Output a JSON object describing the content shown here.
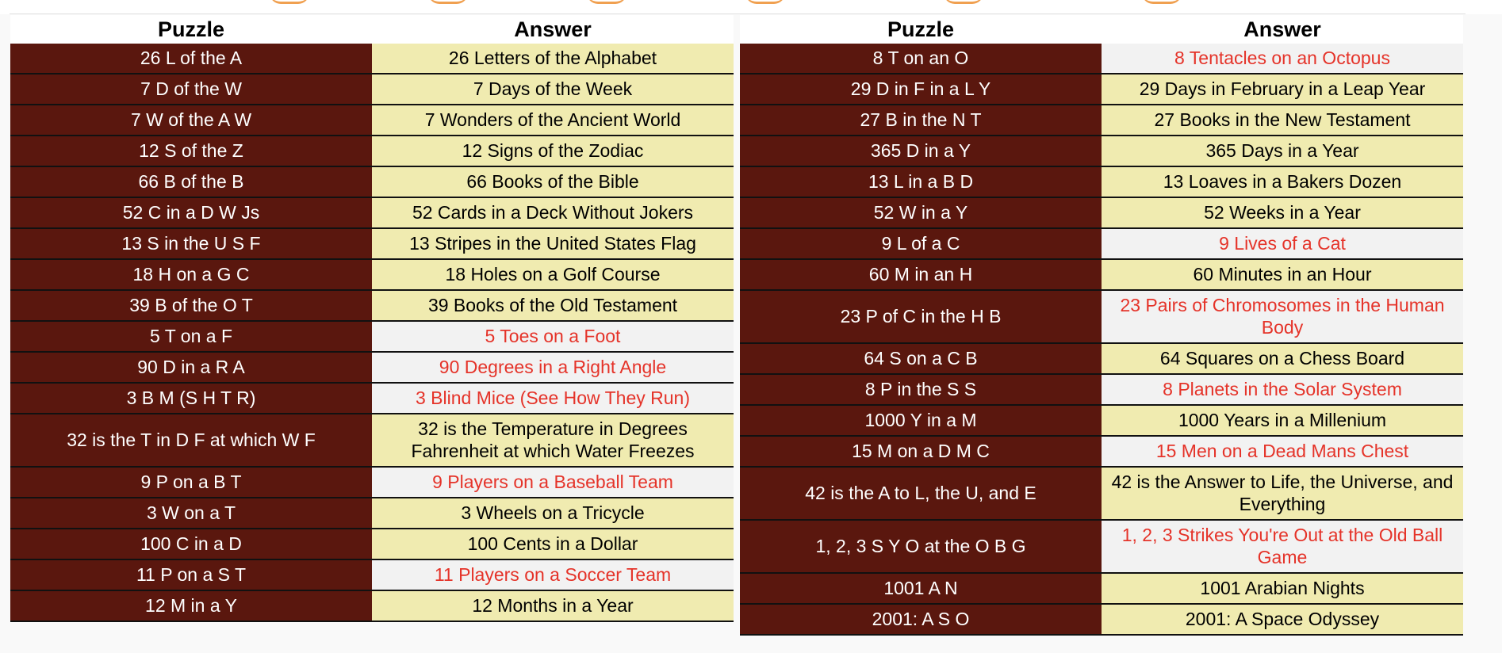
{
  "headers": {
    "puzzle": "Puzzle",
    "answer": "Answer"
  },
  "colors": {
    "puzzle_bg": "#5a170e",
    "answer_bg": "#f0ebb0",
    "highlight_bg": "#f2f2f2",
    "highlight_text": "#e53329"
  },
  "left_rows": [
    {
      "puzzle": "26 L of the A",
      "answer": "26 Letters of the Alphabet",
      "highlighted": false
    },
    {
      "puzzle": "7 D of the W",
      "answer": "7 Days of the Week",
      "highlighted": false
    },
    {
      "puzzle": "7 W of the A W",
      "answer": "7 Wonders of the Ancient World",
      "highlighted": false
    },
    {
      "puzzle": "12 S of the Z",
      "answer": "12 Signs of the Zodiac",
      "highlighted": false
    },
    {
      "puzzle": "66 B of the B",
      "answer": "66 Books of the Bible",
      "highlighted": false
    },
    {
      "puzzle": "52 C in a D W Js",
      "answer": "52 Cards in a Deck Without Jokers",
      "highlighted": false
    },
    {
      "puzzle": "13 S in the U S F",
      "answer": "13 Stripes in the United States Flag",
      "highlighted": false
    },
    {
      "puzzle": "18 H on a G C",
      "answer": "18 Holes on a Golf Course",
      "highlighted": false
    },
    {
      "puzzle": "39 B of the O T",
      "answer": "39 Books of the Old Testament",
      "highlighted": false
    },
    {
      "puzzle": "5 T on a F",
      "answer": "5 Toes on a Foot",
      "highlighted": true
    },
    {
      "puzzle": "90 D in a R A",
      "answer": "90 Degrees in a Right Angle",
      "highlighted": true
    },
    {
      "puzzle": "3 B M (S H T R)",
      "answer": "3 Blind Mice (See How They Run)",
      "highlighted": true
    },
    {
      "puzzle": "32 is the T in D F at which W F",
      "answer": "32 is the Temperature in Degrees Fahrenheit at which Water Freezes",
      "highlighted": false
    },
    {
      "puzzle": "9 P on a B T",
      "answer": "9 Players on a Baseball Team",
      "highlighted": true
    },
    {
      "puzzle": "3 W on a T",
      "answer": "3 Wheels on a Tricycle",
      "highlighted": false
    },
    {
      "puzzle": "100 C in a D",
      "answer": "100 Cents in a Dollar",
      "highlighted": false
    },
    {
      "puzzle": "11 P on a S T",
      "answer": "11 Players on a Soccer Team",
      "highlighted": true
    },
    {
      "puzzle": "12 M in a Y",
      "answer": "12 Months in a Year",
      "highlighted": false
    }
  ],
  "right_rows": [
    {
      "puzzle": "8 T on an O",
      "answer": "8 Tentacles on an Octopus",
      "highlighted": true
    },
    {
      "puzzle": "29 D in F in a L Y",
      "answer": "29 Days in February in a Leap Year",
      "highlighted": false
    },
    {
      "puzzle": "27 B in the N T",
      "answer": "27 Books in the New Testament",
      "highlighted": false
    },
    {
      "puzzle": "365 D in a Y",
      "answer": "365 Days in a Year",
      "highlighted": false
    },
    {
      "puzzle": "13 L in a B D",
      "answer": "13 Loaves in a Bakers Dozen",
      "highlighted": false
    },
    {
      "puzzle": "52 W in a Y",
      "answer": "52 Weeks in a Year",
      "highlighted": false
    },
    {
      "puzzle": "9 L of a C",
      "answer": "9 Lives of a Cat",
      "highlighted": true
    },
    {
      "puzzle": "60 M in an H",
      "answer": "60 Minutes in an Hour",
      "highlighted": false
    },
    {
      "puzzle": "23 P of C in the H B",
      "answer": "23 Pairs of Chromosomes in the Human Body",
      "highlighted": true
    },
    {
      "puzzle": "64 S on a C B",
      "answer": "64 Squares on a Chess Board",
      "highlighted": false
    },
    {
      "puzzle": "8 P in the S S",
      "answer": "8 Planets in the Solar System",
      "highlighted": true
    },
    {
      "puzzle": "1000 Y in a M",
      "answer": "1000 Years in a Millenium",
      "highlighted": false
    },
    {
      "puzzle": "15 M on a D M C",
      "answer": "15 Men on a Dead Mans Chest",
      "highlighted": true
    },
    {
      "puzzle": "42 is the A to L, the U, and E",
      "answer": "42 is the Answer to Life, the Universe, and Everything",
      "highlighted": false
    },
    {
      "puzzle": "1, 2, 3 S Y O at the O B G",
      "answer": "1, 2, 3 Strikes You're Out at the Old Ball Game",
      "highlighted": true
    },
    {
      "puzzle": "1001 A N",
      "answer": "1001 Arabian Nights",
      "highlighted": false
    },
    {
      "puzzle": "2001: A S O",
      "answer": "2001: A Space Odyssey",
      "highlighted": false
    }
  ]
}
